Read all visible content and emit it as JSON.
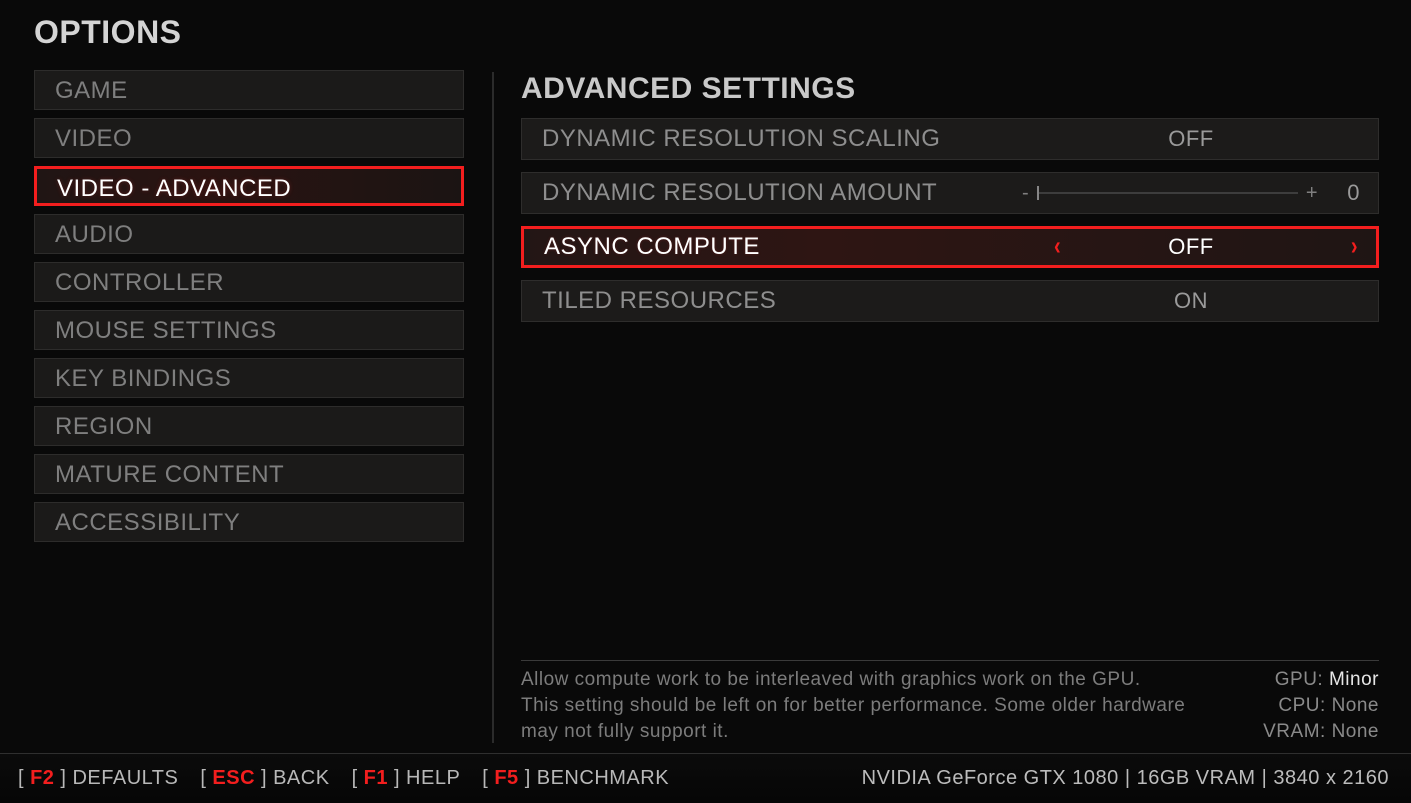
{
  "title": "OPTIONS",
  "panel_title": "ADVANCED SETTINGS",
  "sidebar": {
    "items": [
      {
        "label": "GAME",
        "selected": false
      },
      {
        "label": "VIDEO",
        "selected": false
      },
      {
        "label": "VIDEO - ADVANCED",
        "selected": true
      },
      {
        "label": "AUDIO",
        "selected": false
      },
      {
        "label": "CONTROLLER",
        "selected": false
      },
      {
        "label": "MOUSE SETTINGS",
        "selected": false
      },
      {
        "label": "KEY BINDINGS",
        "selected": false
      },
      {
        "label": "REGION",
        "selected": false
      },
      {
        "label": "MATURE CONTENT",
        "selected": false
      },
      {
        "label": "ACCESSIBILITY",
        "selected": false
      }
    ]
  },
  "settings": {
    "rows": [
      {
        "label": "DYNAMIC RESOLUTION SCALING",
        "type": "toggle",
        "value": "OFF",
        "selected": false
      },
      {
        "label": "DYNAMIC RESOLUTION AMOUNT",
        "type": "slider",
        "value": "0",
        "minus": "-",
        "plus": "+",
        "selected": false
      },
      {
        "label": "ASYNC COMPUTE",
        "type": "toggle",
        "value": "OFF",
        "selected": true
      },
      {
        "label": "TILED RESOURCES",
        "type": "toggle",
        "value": "ON",
        "selected": false
      }
    ]
  },
  "description": {
    "line1": "Allow compute work to be interleaved with graphics work on the GPU.",
    "line2": "This setting should be left on for better performance. Some older hardware may not fully support it."
  },
  "impact": {
    "gpu_label": "GPU: ",
    "gpu_value": "Minor",
    "cpu_label": "CPU: ",
    "cpu_value": "None",
    "vram_label": "VRAM: ",
    "vram_value": "None"
  },
  "hotkeys": [
    {
      "key": "F2",
      "label": "DEFAULTS"
    },
    {
      "key": "ESC",
      "label": "BACK"
    },
    {
      "key": "F1",
      "label": "HELP"
    },
    {
      "key": "F5",
      "label": "BENCHMARK"
    }
  ],
  "sysinfo": "NVIDIA GeForce GTX 1080 | 16GB VRAM | 3840 x 2160"
}
